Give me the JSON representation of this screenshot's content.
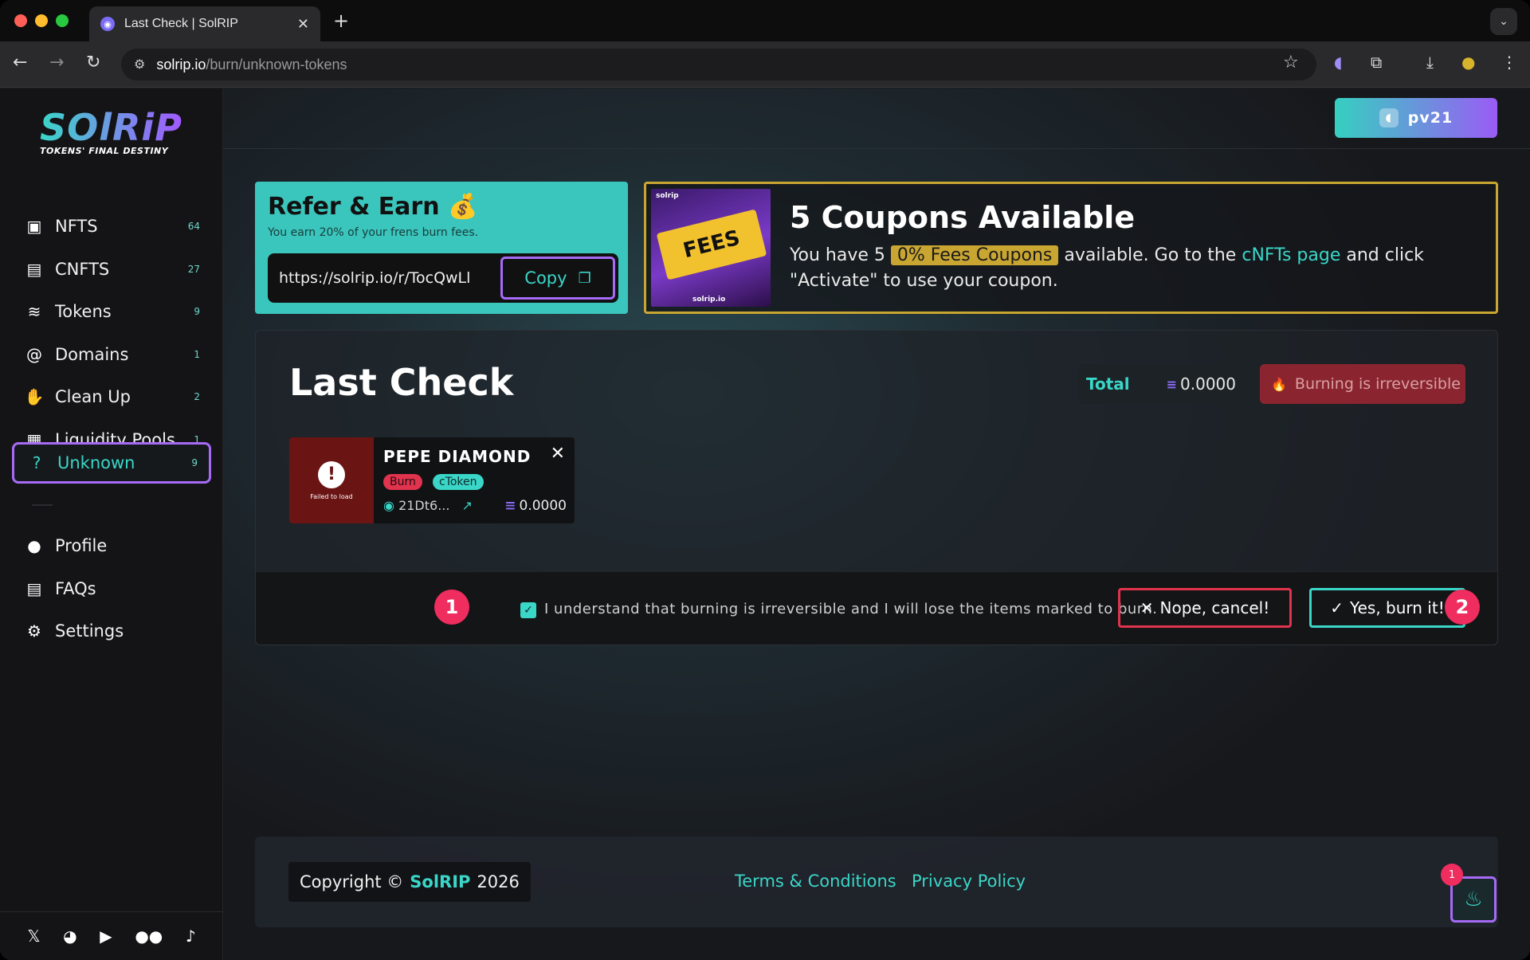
{
  "browser": {
    "tab_title": "Last Check | SolRIP",
    "url_host": "solrip.io",
    "url_path": "/burn/unknown-tokens",
    "new_tab": "+",
    "tab_close": "✕"
  },
  "brand": {
    "logo": "SOlRiP",
    "tagline": "TOKENS' FINAL DESTINY",
    "accent": "#3ad6c8",
    "accent2": "#a76af7"
  },
  "sidebar": {
    "items": [
      {
        "label": "NFTS",
        "count": "64",
        "icon": "image-icon"
      },
      {
        "label": "CNFTS",
        "count": "27",
        "icon": "file-icon"
      },
      {
        "label": "Tokens",
        "count": "9",
        "icon": "coins-icon"
      },
      {
        "label": "Domains",
        "count": "1",
        "icon": "at-icon"
      },
      {
        "label": "Clean Up",
        "count": "2",
        "icon": "hand-icon"
      },
      {
        "label": "Liquidity Pools",
        "count": "1",
        "icon": "box-icon"
      },
      {
        "label": "Unknown",
        "count": "9",
        "icon": "question-icon"
      }
    ],
    "secondary": [
      {
        "label": "Profile",
        "icon": "user-icon"
      },
      {
        "label": "FAQs",
        "icon": "document-icon"
      },
      {
        "label": "Settings",
        "icon": "gear-icon"
      }
    ]
  },
  "header": {
    "wallet_label": "pv21"
  },
  "refer": {
    "title": "Refer & Earn 💰",
    "subtitle": "You earn 20% of your frens burn fees.",
    "url": "https://solrip.io/r/TocQwLl",
    "copy_label": "Copy"
  },
  "coupon": {
    "title": "5 Coupons Available",
    "text_before": "You have 5",
    "highlight": "0% Fees Coupons",
    "text_mid": "available. Go to the",
    "link": "cNFTs page",
    "text_after": "and click \"Activate\" to use your coupon.",
    "image_label": "FEES",
    "image_brand": "solrip",
    "image_footer": "solrip.io"
  },
  "main": {
    "title": "Last Check",
    "total_label": "Total",
    "total_value": "0.0000",
    "warning": "Burning is irreversible",
    "token": {
      "name": "PEPE DIAMOND",
      "thumb_text": "Failed to load",
      "tag_burn": "Burn",
      "tag_type": "cToken",
      "address": "21Dt6...",
      "value": "0.0000"
    },
    "confirm_text": "I understand that burning is irreversible and I will lose the items marked to burn.",
    "step1": "1",
    "step2": "2",
    "cancel_label": "Nope, cancel!",
    "burn_label": "Yes, burn it!"
  },
  "footer": {
    "copyright_prefix": "Copyright ©",
    "brand": "SolRIP",
    "year": "2026",
    "terms": "Terms & Conditions",
    "privacy": "Privacy Policy",
    "fab_badge": "1"
  }
}
